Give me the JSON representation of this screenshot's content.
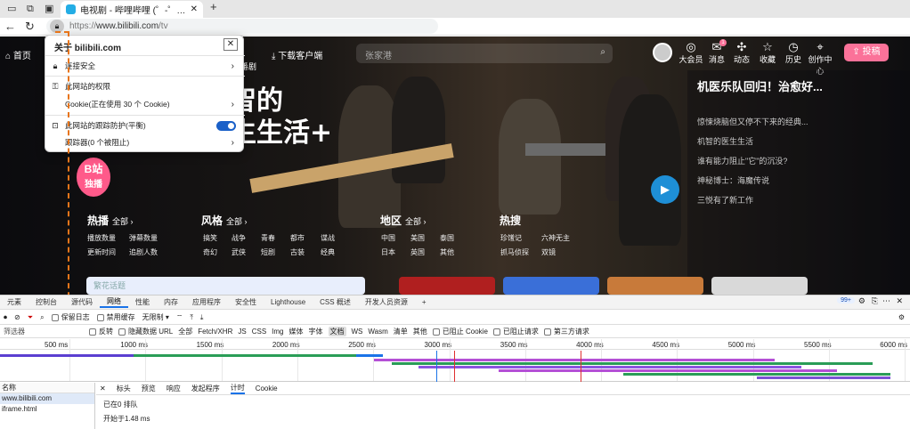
{
  "browser": {
    "tab_title": "电视剧 - 哔哩哔哩 (゜-゜)つロ 干杯~-bilibili",
    "url_prefix": "https://",
    "url_host": "www.bilibili.com",
    "url_path": "/tv"
  },
  "site": {
    "nav_home": "首页",
    "nav_partial": "番剧",
    "nav_client": "下载客户端",
    "search_placeholder": "张家港",
    "right_icons": [
      {
        "icon": "vip-icon",
        "label": "大会员"
      },
      {
        "icon": "message-icon",
        "label": "消息"
      },
      {
        "icon": "dynamic-icon",
        "label": "动态"
      },
      {
        "icon": "favorite-icon",
        "label": "收藏"
      },
      {
        "icon": "history-icon",
        "label": "历史"
      },
      {
        "icon": "creator-icon",
        "label": "创作中心"
      }
    ],
    "msg_badge": "1",
    "upload_label": "投稿",
    "hero_title_line1": "机智的",
    "hero_title_line2": "医生生活+",
    "side_headline": "机医乐队回归！治愈好...",
    "side_items": [
      "惊悚烧脑但又停不下来的经典...",
      "机智的医生生活",
      "谁有能力阻止\"它\"的沉没?",
      "神秘博士：海魔传说",
      "三悦有了新工作"
    ],
    "badge_line1": "B站",
    "badge_line2": "独播",
    "categories": [
      {
        "title": "热播",
        "more": "全部 ›",
        "cells": [
          "播放数量",
          "弹幕数量",
          "更新时间",
          "追剧人数"
        ]
      },
      {
        "title": "风格",
        "more": "全部 ›",
        "cells": [
          "搞笑",
          "战争",
          "青春",
          "都市",
          "谍战",
          "奇幻",
          "武侠",
          "短剧",
          "古装",
          "经典"
        ]
      },
      {
        "title": "地区",
        "more": "全部 ›",
        "cells": [
          "中国",
          "美国",
          "泰国",
          "日本",
          "英国",
          "其他"
        ]
      },
      {
        "title": "热搜",
        "more": "",
        "cells": [
          "珍馐记",
          "六神无主",
          "抓马侦探",
          "双镜"
        ]
      }
    ],
    "banner_partial": "繁花话题"
  },
  "popup": {
    "title": "关于 bilibili.com",
    "close": "✕",
    "rows": [
      {
        "label": "连接安全",
        "icon": "lock-icon"
      },
      {
        "label": "此网站的权限",
        "icon": "key-icon"
      },
      {
        "label": "Cookie(正在使用 30 个 Cookie)",
        "icon": ""
      },
      {
        "label": "此网站的跟踪防护(平衡)",
        "icon": "tracking-icon"
      },
      {
        "label": "跟踪器(0 个被阻止)",
        "icon": ""
      }
    ]
  },
  "devtools": {
    "tabs": [
      "元素",
      "控制台",
      "源代码",
      "网络",
      "性能",
      "内存",
      "应用程序",
      "安全性",
      "Lighthouse",
      "CSS 概述",
      "开发人员资源"
    ],
    "active_tab": "网络",
    "issues": "99+",
    "toolbar": {
      "preserve_log": "保留日志",
      "disable_cache": "禁用缓存",
      "throttle": "无限制"
    },
    "filter_label": "筛选器",
    "filter_types": [
      "反转",
      "隐藏数据 URL",
      "全部",
      "Fetch/XHR",
      "JS",
      "CSS",
      "Img",
      "媒体",
      "字体",
      "文档",
      "WS",
      "Wasm",
      "清单",
      "其他"
    ],
    "filter_active": "文档",
    "filter_checks": [
      "已阻止 Cookie",
      "已阻止请求",
      "第三方请求"
    ],
    "ticks": [
      "500 ms",
      "1000 ms",
      "1500 ms",
      "2000 ms",
      "2500 ms",
      "3000 ms",
      "3500 ms",
      "4000 ms",
      "4500 ms",
      "5000 ms",
      "5500 ms",
      "6000 ms"
    ],
    "col_name": "名称",
    "requests": [
      "www.bilibili.com",
      "iframe.html"
    ],
    "detail_tabs": [
      "标头",
      "预览",
      "响应",
      "发起程序",
      "计时",
      "Cookie"
    ],
    "detail_active": "计时",
    "detail_lines": [
      "已在0 排队",
      "开始于1.48 ms"
    ]
  },
  "colors": {
    "accent": "#fb7299",
    "annotation": "#e8751a",
    "devtools_blue": "#1a73e8"
  }
}
